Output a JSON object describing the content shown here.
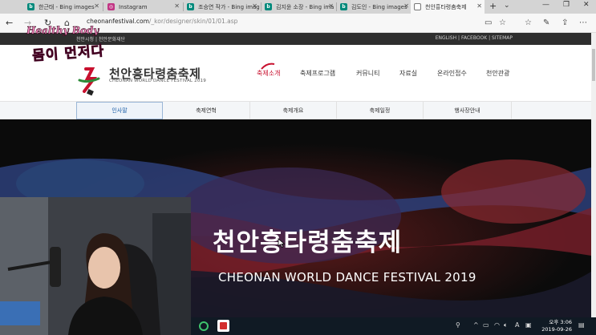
{
  "browser": {
    "tabs": [
      {
        "label": "한근태 - Bing images",
        "favicon": "bing-icon",
        "color": "#00897b"
      },
      {
        "label": "Instagram",
        "favicon": "instagram-icon",
        "color": "#c13584"
      },
      {
        "label": "조승연 작가 - Bing images",
        "favicon": "bing-icon",
        "color": "#00897b"
      },
      {
        "label": "김지윤 소장 - Bing ima",
        "favicon": "bing-icon",
        "color": "#00897b"
      },
      {
        "label": "김도인 - Bing images",
        "favicon": "bing-icon",
        "color": "#00897b"
      },
      {
        "label": "천안흥타령춤축제",
        "favicon": "page-icon",
        "color": "#777777",
        "active": true
      }
    ],
    "new_tab": "+",
    "tab_list": "⌄",
    "url_host": "cheonanfestival.com",
    "url_path": "/_kor/designer/skin/01/01.asp"
  },
  "site": {
    "util_left": "천안시청  |  천안문화재단",
    "util_right": "ENGLISH  |  FACEBOOK  |  SITEMAP",
    "logo_title": "천안흥타령춤축제",
    "logo_sub": "CHEONAN WORLD DANCE FESTIVAL 2019",
    "nav": [
      "축제소개",
      "축제프로그램",
      "커뮤니티",
      "자료실",
      "온라인접수",
      "천안관광"
    ],
    "subnav": [
      "인사말",
      "축제연혁",
      "축제개요",
      "축제일정",
      "행사장안내"
    ],
    "hero_title": "천안흥타령춤축제",
    "hero_sub": "CHEONAN WORLD DANCE FESTIVAL 2019"
  },
  "overlay": {
    "line1": "Healthy Body",
    "line2": "몸이 먼저다"
  },
  "taskbar": {
    "time": "오후 3:06",
    "date": "2019-09-26",
    "ime": "A"
  },
  "colors": {
    "accent_red": "#c8102e",
    "subnav_active": "#1c5fa8"
  }
}
